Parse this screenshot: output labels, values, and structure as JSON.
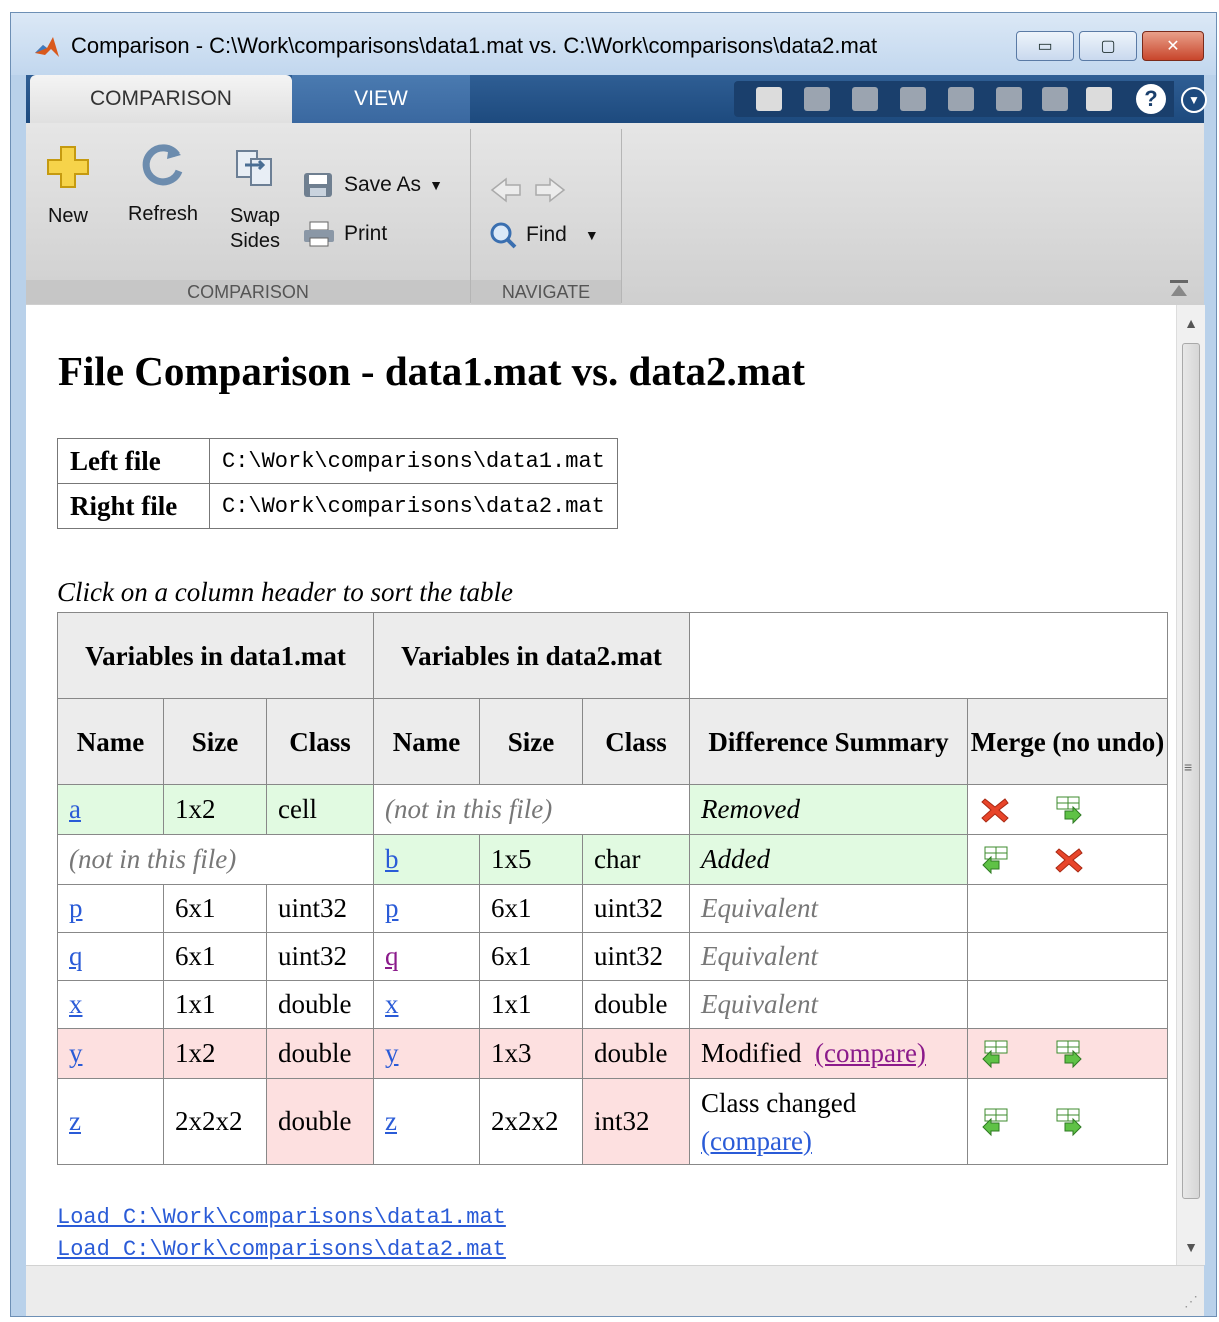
{
  "window": {
    "title": "Comparison - C:\\Work\\comparisons\\data1.mat vs. C:\\Work\\comparisons\\data2.mat",
    "buttons": {
      "minimize": "▭",
      "maximize": "▢",
      "close": "✕"
    }
  },
  "tabs": [
    {
      "label": "COMPARISON",
      "active": true
    },
    {
      "label": "VIEW",
      "active": false
    }
  ],
  "ribbon": {
    "new_label": "New",
    "refresh_label": "Refresh",
    "swap_label_1": "Swap",
    "swap_label_2": "Sides",
    "save_as_label": "Save As",
    "print_label": "Print",
    "find_label": "Find",
    "section_comparison": "COMPARISON",
    "section_navigate": "NAVIGATE",
    "help": "?"
  },
  "page": {
    "title": "File Comparison - data1.mat vs. data2.mat",
    "files": [
      {
        "key": "Left file",
        "value": "C:\\Work\\comparisons\\data1.mat"
      },
      {
        "key": "Right file",
        "value": "C:\\Work\\comparisons\\data2.mat"
      }
    ],
    "sort_hint": "Click on a column header to sort the table",
    "group_left": "Variables in data1.mat",
    "group_right": "Variables in data2.mat",
    "columns": [
      "Name",
      "Size",
      "Class",
      "Name",
      "Size",
      "Class",
      "Difference Summary",
      "Merge (no undo)"
    ],
    "not_in_file": "(not in this file)",
    "rows": [
      {
        "l_name": "a",
        "l_size": "1x2",
        "l_class": "cell",
        "summary": "Removed"
      },
      {
        "r_name": "b",
        "r_size": "1x5",
        "r_class": "char",
        "summary": "Added"
      },
      {
        "l_name": "p",
        "l_size": "6x1",
        "l_class": "uint32",
        "r_name": "p",
        "r_size": "6x1",
        "r_class": "uint32",
        "summary": "Equivalent"
      },
      {
        "l_name": "q",
        "l_size": "6x1",
        "l_class": "uint32",
        "r_name": "q",
        "r_size": "6x1",
        "r_class": "uint32",
        "summary": "Equivalent"
      },
      {
        "l_name": "x",
        "l_size": "1x1",
        "l_class": "double",
        "r_name": "x",
        "r_size": "1x1",
        "r_class": "double",
        "summary": "Equivalent"
      },
      {
        "l_name": "y",
        "l_size": "1x2",
        "l_class": "double",
        "r_name": "y",
        "r_size": "1x3",
        "r_class": "double",
        "summary": "Modified",
        "compare": "(compare)"
      },
      {
        "l_name": "z",
        "l_size": "2x2x2",
        "l_class": "double",
        "r_name": "z",
        "r_size": "2x2x2",
        "r_class": "int32",
        "summary": "Class changed",
        "compare": "(compare)"
      }
    ],
    "load_links": [
      "Load C:\\Work\\comparisons\\data1.mat",
      "Load C:\\Work\\comparisons\\data2.mat"
    ]
  },
  "colors": {
    "added_removed_bg": "#e1fae1",
    "modified_bg": "#fde0e0",
    "link": "#2a5bd7",
    "visited_link": "#8b1a8b",
    "ribbon_tab_bg": "#1d4a7e"
  }
}
